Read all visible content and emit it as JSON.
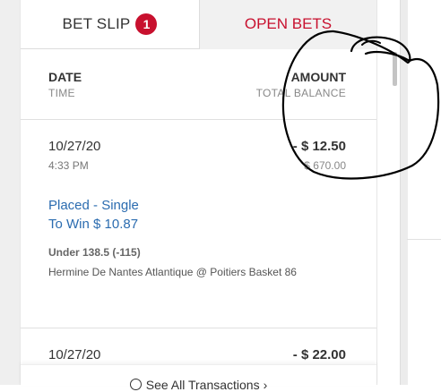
{
  "tabs": {
    "bet_slip_label": "BET SLIP",
    "bet_slip_count": "1",
    "open_bets_label": "OPEN BETS"
  },
  "header": {
    "date": "DATE",
    "time": "TIME",
    "amount": "AMOUNT",
    "total_balance": "TOTAL BALANCE"
  },
  "transactions": [
    {
      "date": "10/27/20",
      "time": "4:33 PM",
      "amount": "- $ 12.50",
      "balance": "$ 670.00",
      "bet_type": "Placed - Single",
      "to_win": "To Win $ 10.87",
      "selection": "Under 138.5 (-115)",
      "event": "Hermine De Nantes Atlantique @ Poitiers Basket 86"
    },
    {
      "date": "10/27/20",
      "amount": "- $ 22.00"
    }
  ],
  "footer": {
    "see_all": "See All Transactions",
    "icon": "history-icon"
  },
  "colors": {
    "accent_red": "#c8102e",
    "link_blue": "#2b6cb0",
    "annotation": "#000000"
  }
}
